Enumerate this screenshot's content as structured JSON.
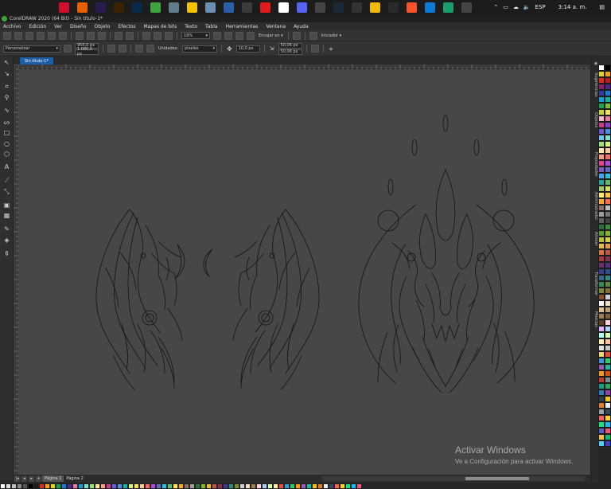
{
  "window": {
    "title": "CorelDRAW 2020 (64 Bit) - Sin título-1*"
  },
  "taskbar": {
    "icons": [
      {
        "name": "windows-start",
        "color": "#1c1c1c"
      },
      {
        "name": "search",
        "color": "#1c1c1c"
      },
      {
        "name": "task-view",
        "color": "#1c1c1c"
      },
      {
        "name": "opera",
        "color": "#d0102b"
      },
      {
        "name": "firefox",
        "color": "#e66000"
      },
      {
        "name": "after-effects",
        "color": "#2a1b4f"
      },
      {
        "name": "illustrator",
        "color": "#3b2200"
      },
      {
        "name": "photoshop",
        "color": "#0a2a4a"
      },
      {
        "name": "coreldraw",
        "color": "#3fa33f"
      },
      {
        "name": "file-explorer",
        "color": "#607d8b"
      },
      {
        "name": "sticky-notes",
        "color": "#f2c400"
      },
      {
        "name": "documents",
        "color": "#6a8fb0"
      },
      {
        "name": "store",
        "color": "#2b5ea8"
      },
      {
        "name": "xbox",
        "color": "#3b3b3b"
      },
      {
        "name": "youtube",
        "color": "#e01c1c"
      },
      {
        "name": "gmail",
        "color": "#ffffff"
      },
      {
        "name": "discord",
        "color": "#5865f2"
      },
      {
        "name": "utility",
        "color": "#444444"
      },
      {
        "name": "steam",
        "color": "#1b2838"
      },
      {
        "name": "utorrent",
        "color": "#333333"
      },
      {
        "name": "binance",
        "color": "#f0b90b"
      },
      {
        "name": "epic-games",
        "color": "#2a2a2a"
      },
      {
        "name": "brave",
        "color": "#fb542b"
      },
      {
        "name": "edge",
        "color": "#0f7ad5"
      },
      {
        "name": "chrome-like",
        "color": "#1a9e6b"
      },
      {
        "name": "settings",
        "color": "#444444"
      }
    ],
    "language": "ESP",
    "clock": "3:14 a. m."
  },
  "menu": [
    "Archivo",
    "Edición",
    "Ver",
    "Diseño",
    "Objeto",
    "Efectos",
    "Mapas de bits",
    "Texto",
    "Tabla",
    "Herramientas",
    "Ventana",
    "Ayuda"
  ],
  "toolbar": {
    "zoom": "19%",
    "snap_label": "Encajar en",
    "launch_label": "Iniciador"
  },
  "properties": {
    "preset": "Personalizar",
    "page_width": "950,0 px",
    "page_height": "1.080,0 px",
    "units_label": "Unidades:",
    "units_value": "píxeles",
    "nudge": "10,0 px",
    "dup_x": "50,06 px",
    "dup_y": "50,06 px"
  },
  "document": {
    "tab": "Sin título-1*"
  },
  "pages": [
    "Página 1",
    "Página 2"
  ],
  "watermark": {
    "title": "Activar Windows",
    "subtitle": "Ve a Configuración para activar Windows."
  },
  "dockers": [
    "Sugerencias",
    "Objetos",
    "Propiedades",
    "Administrador",
    "Alinear",
    "Transformar",
    "Mezclas"
  ],
  "colors": {
    "canvas": "#474747",
    "outline": "#141414",
    "accent": "#1c5fa8"
  },
  "palette": [
    "#ffffff",
    "#000000",
    "#e8d417",
    "#f4a300",
    "#e22a1b",
    "#b81a1a",
    "#8e1f6b",
    "#4b2a86",
    "#2e3da8",
    "#1c7ad6",
    "#13a2d8",
    "#12b3a4",
    "#16a34a",
    "#7ebf2a",
    "#c6d92e",
    "#f7e64b",
    "#f2b8c6",
    "#e87aa3",
    "#c93d8f",
    "#8f3fc4",
    "#6a5ad6",
    "#4e8fe0",
    "#6fc5f0",
    "#7fe0d2",
    "#9de07f",
    "#d8f07a",
    "#ffe8a3",
    "#ffc999",
    "#ff9c82",
    "#ff6b6b",
    "#e84393",
    "#b24ad8",
    "#7e57c2",
    "#5c6bc0",
    "#42a5f5",
    "#26c6da",
    "#26a69a",
    "#66bb6a",
    "#9ccc65",
    "#d4e157",
    "#ffee58",
    "#ffca28",
    "#ffa726",
    "#ff7043",
    "#8d6e63",
    "#bdbdbd",
    "#9e9e9e",
    "#757575",
    "#616161",
    "#424242",
    "#2f6f3e",
    "#3b8c3b",
    "#5aa02c",
    "#87b52a",
    "#b5c52f",
    "#d8cf3a",
    "#e8b93b",
    "#e89a3b",
    "#d8773b",
    "#c2553b",
    "#a63b3b",
    "#8a2f52",
    "#6e2f6e",
    "#552f7e",
    "#3b3b8a",
    "#2f4f8a",
    "#2f6e8a",
    "#2f8a7e",
    "#3b8a5a",
    "#5a8a3b",
    "#7e8a2f",
    "#8a6e2f",
    "#8a4f2f",
    "#cfcfcf",
    "#ffffff",
    "#f0e0c0",
    "#e0c090",
    "#c0a070",
    "#a08050",
    "#806040",
    "#604020",
    "#ffd0e0",
    "#e0b0ff",
    "#b0d0ff",
    "#b0fff0",
    "#d0ffb0",
    "#fff0b0",
    "#ffc0a0",
    "#e0e0e0",
    "#c8c8c8",
    "#f5d76e",
    "#e74c3c",
    "#3498db",
    "#2ecc71",
    "#9b59b6",
    "#1abc9c",
    "#f39c12",
    "#d35400",
    "#c0392b",
    "#7f8c8d",
    "#16a085",
    "#27ae60",
    "#2980b9",
    "#8e44ad",
    "#2c3e50",
    "#f1c40f",
    "#e67e22",
    "#ecf0f1",
    "#95a5a6",
    "#34495e",
    "#ff5e57",
    "#ffd32a",
    "#0be881",
    "#0fbcf9",
    "#575fcf",
    "#ef5777",
    "#ffc048",
    "#05c46b",
    "#4bcffa",
    "#3c40c6"
  ],
  "bottom_palette": [
    "#ffffff",
    "#e0e0e0",
    "#bdbdbd",
    "#8a8a8a",
    "#555555",
    "#000000",
    "#1c1c1c",
    "#e22a1b",
    "#f4a300",
    "#e8d417",
    "#16a34a",
    "#1c7ad6",
    "#4b2a86",
    "#e87aa3",
    "#13a2d8",
    "#7fe0d2",
    "#9de07f",
    "#ffe8a3",
    "#ff9c82",
    "#c93d8f",
    "#6a5ad6",
    "#4e8fe0",
    "#12b3a4",
    "#d8f07a",
    "#f7e64b",
    "#ffc999",
    "#ff6b6b",
    "#b24ad8",
    "#5c6bc0",
    "#26c6da",
    "#66bb6a",
    "#ffee58",
    "#ffa726",
    "#8d6e63",
    "#9e9e9e",
    "#2f6f3e",
    "#87b52a",
    "#e8b93b",
    "#c2553b",
    "#8a2f52",
    "#3b3b8a",
    "#2f8a7e",
    "#7e8a2f",
    "#cfcfcf",
    "#f0e0c0",
    "#a08050",
    "#ffd0e0",
    "#b0d0ff",
    "#d0ffb0",
    "#fff0b0",
    "#e74c3c",
    "#3498db",
    "#2ecc71",
    "#f39c12",
    "#9b59b6",
    "#1abc9c",
    "#f1c40f",
    "#e67e22",
    "#ecf0f1",
    "#34495e",
    "#ff5e57",
    "#ffd32a",
    "#0be881",
    "#0fbcf9",
    "#ef5777"
  ]
}
